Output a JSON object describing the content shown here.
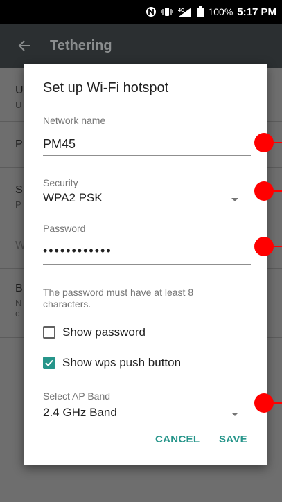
{
  "status_bar": {
    "network": "4G",
    "battery": "100%",
    "time": "5:17 PM"
  },
  "app_bar": {
    "title": "Tethering",
    "back_icon": "arrow-left-icon"
  },
  "background": {
    "rows": [
      {
        "title": "U",
        "subtitle": "U"
      },
      {
        "title": "P",
        "subtitle": ""
      },
      {
        "title": "S",
        "subtitle": "P"
      },
      {
        "title": "W",
        "subtitle": ""
      },
      {
        "title": "B",
        "subtitle": "N\nc"
      }
    ]
  },
  "dialog": {
    "title": "Set up Wi-Fi hotspot",
    "network_name_label": "Network name",
    "network_name_value": "PM45",
    "security_label": "Security",
    "security_value": "WPA2 PSK",
    "password_label": "Password",
    "password_value": "••••••••••••",
    "hint": "The password must have at least 8 characters.",
    "show_password_label": "Show password",
    "show_password_checked": false,
    "show_wps_label": "Show wps push button",
    "show_wps_checked": true,
    "ap_band_label": "Select AP Band",
    "ap_band_value": "2.4 GHz Band",
    "cancel_label": "CANCEL",
    "save_label": "SAVE"
  },
  "colors": {
    "accent": "#26958a",
    "annotation": "#ff0000"
  }
}
